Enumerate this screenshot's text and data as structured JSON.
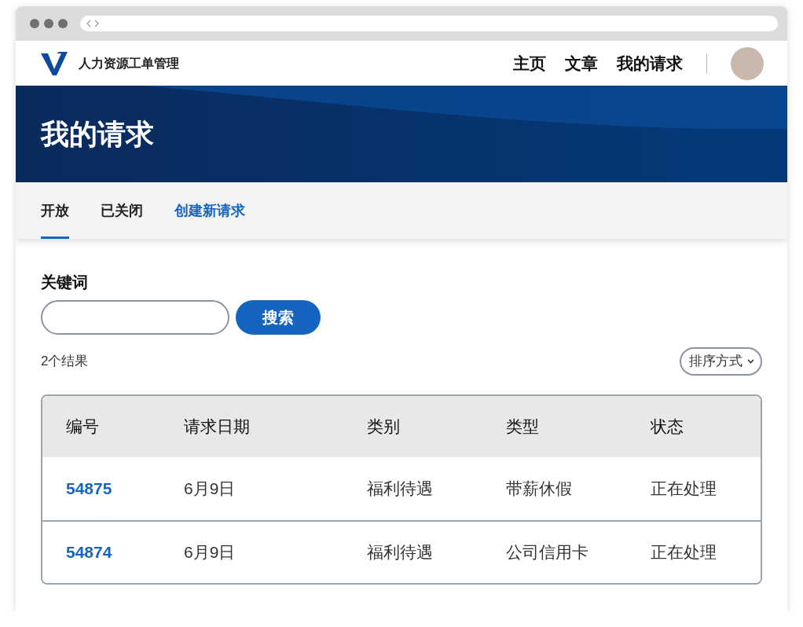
{
  "site": {
    "title": "人力资源工单管理",
    "nav": [
      {
        "label": "主页"
      },
      {
        "label": "文章"
      },
      {
        "label": "我的请求"
      }
    ]
  },
  "banner": {
    "heading": "我的请求"
  },
  "tabs": [
    {
      "label": "开放",
      "selected": true,
      "kind": "tab"
    },
    {
      "label": "已关闭",
      "selected": false,
      "kind": "tab"
    },
    {
      "label": "创建新请求",
      "selected": false,
      "kind": "link"
    }
  ],
  "search": {
    "label": "关键词",
    "button": "搜索"
  },
  "results": {
    "count": "2个结果",
    "sort": "排序方式"
  },
  "table": {
    "columns": [
      "编号",
      "请求日期",
      "类别",
      "类型",
      "状态"
    ],
    "rows": [
      {
        "id": "54875",
        "date": "6月9日",
        "category": "福利待遇",
        "type": "带薪休假",
        "status": "正在处理"
      },
      {
        "id": "54874",
        "date": "6月9日",
        "category": "福利待遇",
        "type": "公司信用卡",
        "status": "正在处理"
      }
    ]
  }
}
